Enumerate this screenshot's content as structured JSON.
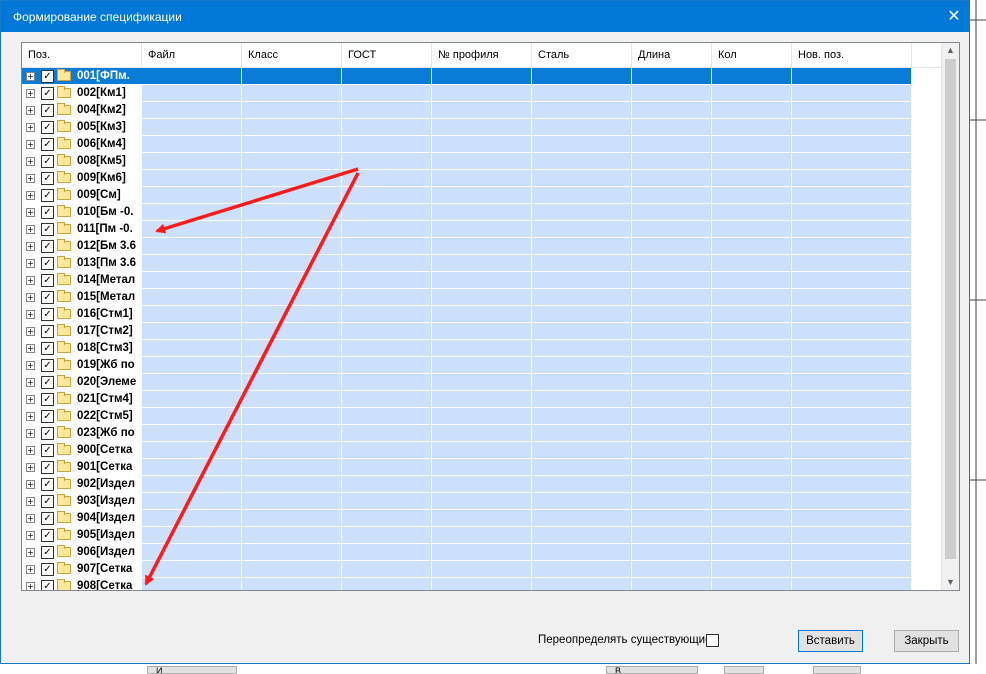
{
  "window": {
    "title": "Формирование спецификации",
    "close_glyph": "✕"
  },
  "grid": {
    "columns": [
      "Поз.",
      "Файл",
      "Класс",
      "ГОСТ",
      "№ профиля",
      "Сталь",
      "Длина",
      "Кол",
      "Нов. поз."
    ],
    "rows": [
      "001[ФПм.",
      "002[Км1]",
      "004[Км2]",
      "005[Км3]",
      "006[Км4]",
      "008[Км5]",
      "009[Км6]",
      "009[См]",
      "010[Бм -0.",
      "011[Пм -0.",
      "012[Бм 3.6",
      "013[Пм 3.6",
      "014[Метал",
      "015[Метал",
      "016[Стм1]",
      "017[Стм2]",
      "018[Стм3]",
      "019[Жб по",
      "020[Элеме",
      "021[Стм4]",
      "022[Стм5]",
      "023[Жб по",
      "900[Сетка",
      "901[Сетка",
      "902[Издел",
      "903[Издел",
      "904[Издел",
      "905[Издел",
      "906[Издел",
      "907[Сетка",
      "908[Сетка"
    ],
    "selected_index": 0,
    "expander_glyph": "+",
    "check_glyph": "✓"
  },
  "footer": {
    "override_label": "Переопределять существующие",
    "override_checked": false,
    "insert_label": "Вставить",
    "close_label": "Закрыть"
  },
  "bottom_strip": {
    "left_btn": "И",
    "mid_btn": "В"
  },
  "colors": {
    "title_bar": "#0078d7",
    "row_fill": "#cce0fb",
    "selected_row": "#0a7bd6",
    "annotation_arrow": "#ff1a1a"
  },
  "icons": [
    "expander-plus-icon",
    "checkbox-checked-icon",
    "folder-icon",
    "close-icon",
    "scroll-up-icon",
    "scroll-down-icon",
    "annotation-arrow"
  ]
}
